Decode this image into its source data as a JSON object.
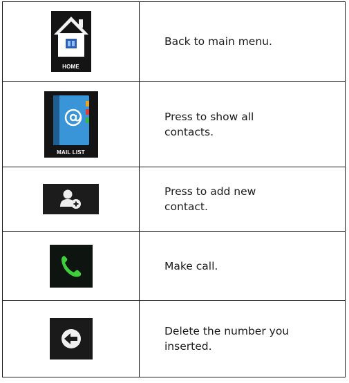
{
  "rows": [
    {
      "icon": "home-icon",
      "icon_label": "HOME",
      "description": "Back to main menu."
    },
    {
      "icon": "mail-list-icon",
      "icon_label": "MAIL LIST",
      "description": "Press to show all contacts."
    },
    {
      "icon": "add-contact-icon",
      "description": "Press to add new contact."
    },
    {
      "icon": "phone-call-icon",
      "description": "Make call."
    },
    {
      "icon": "backspace-arrow-icon",
      "description": "Delete the number you inserted."
    }
  ],
  "colors": {
    "border": "#1a1a1a",
    "icon_background": "#141414",
    "call_green": "#3fcf3a",
    "mail_blue": "#2e86c8"
  }
}
